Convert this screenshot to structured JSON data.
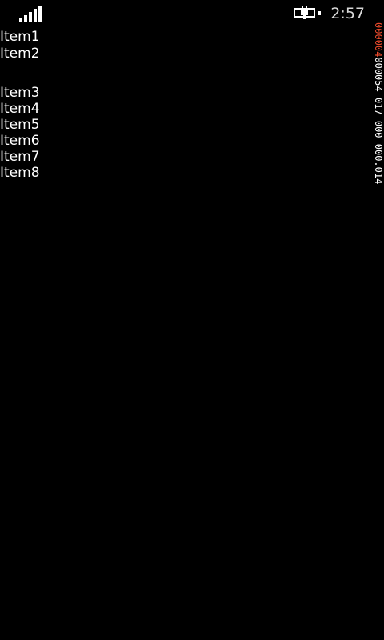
{
  "status_bar": {
    "signal_icon": "signal-strength-icon",
    "battery_icon": "battery-charging-icon",
    "time": "2:57"
  },
  "list": {
    "items": [
      "Item1",
      "Item2",
      "Item3",
      "Item4",
      "Item5",
      "Item6",
      "Item7",
      "Item8"
    ]
  },
  "side_counter": {
    "segments": [
      {
        "text": "000 ",
        "color": "#e8492b"
      },
      {
        "text": "004",
        "color": "#e8492b"
      },
      {
        "text": " 000054 017 000 000.014",
        "color": "#ffffff"
      }
    ]
  },
  "colors": {
    "background": "#000000",
    "text": "#ffffff",
    "counter_accent": "#e8492b"
  }
}
